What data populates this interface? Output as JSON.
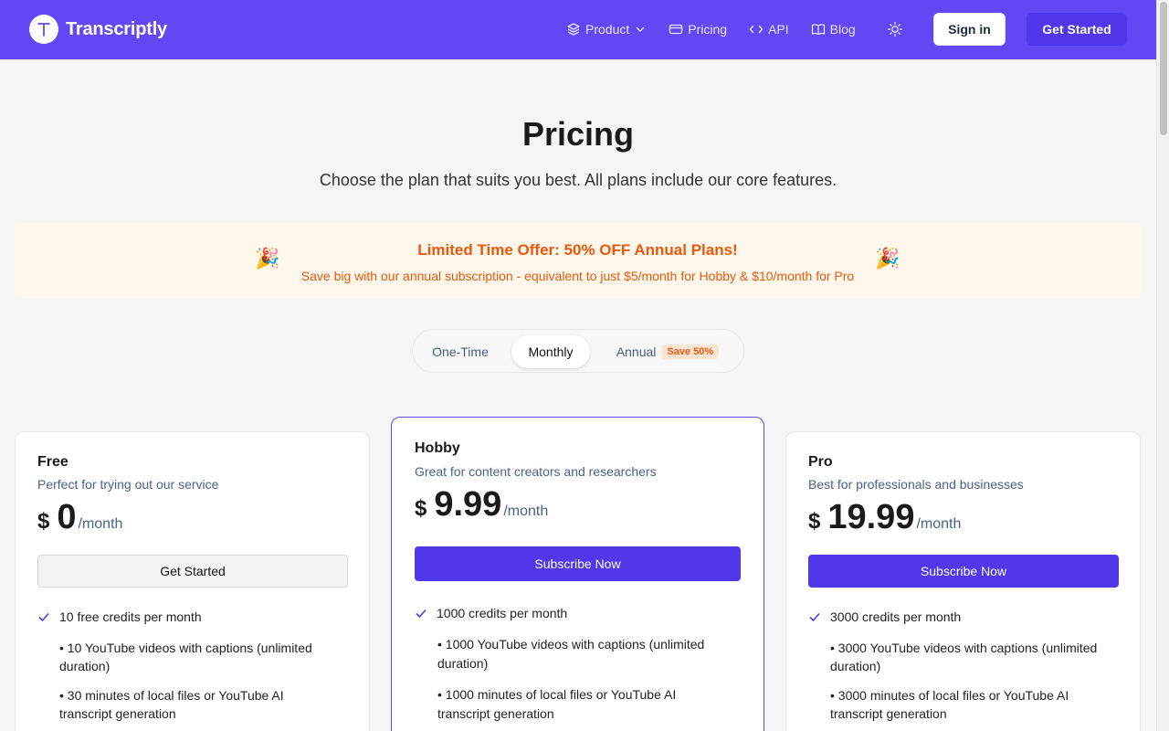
{
  "header": {
    "brand": "Transcriptly",
    "logo_letter": "T",
    "nav": {
      "product": "Product",
      "pricing": "Pricing",
      "api": "API",
      "blog": "Blog"
    },
    "sign_in": "Sign in",
    "get_started": "Get Started"
  },
  "page": {
    "title": "Pricing",
    "subtitle": "Choose the plan that suits you best. All plans include our core features."
  },
  "offer": {
    "title": "Limited Time Offer: 50% OFF Annual Plans!",
    "subtitle": "Save big with our annual subscription - equivalent to just $5/month for Hobby & $10/month for Pro",
    "emoji": "🎉"
  },
  "billing_toggle": {
    "one_time": "One-Time",
    "monthly": "Monthly",
    "annual": "Annual",
    "annual_badge": "Save 50%",
    "selected": "Monthly"
  },
  "plans": [
    {
      "name": "Free",
      "description": "Perfect for trying out our service",
      "currency": "$",
      "price": "0",
      "period": "/month",
      "button": "Get Started",
      "feature": "10 free credits per month",
      "sub_features": [
        "• 10 YouTube videos with captions (unlimited duration)",
        "• 30 minutes of local files or YouTube AI transcript generation"
      ]
    },
    {
      "name": "Hobby",
      "description": "Great for content creators and researchers",
      "currency": "$",
      "price": "9.99",
      "period": "/month",
      "button": "Subscribe Now",
      "feature": "1000 credits per month",
      "sub_features": [
        "• 1000 YouTube videos with captions (unlimited duration)",
        "• 1000 minutes of local files or YouTube AI transcript generation"
      ]
    },
    {
      "name": "Pro",
      "description": "Best for professionals and businesses",
      "currency": "$",
      "price": "19.99",
      "period": "/month",
      "button": "Subscribe Now",
      "feature": "3000 credits per month",
      "sub_features": [
        "• 3000 YouTube videos with captions (unlimited duration)",
        "• 3000 minutes of local files or YouTube AI transcript generation"
      ]
    }
  ],
  "colors": {
    "brand": "#6347f5",
    "primary_button": "#5137ea",
    "offer_text": "#ea580c",
    "offer_bg": "#fff7ec"
  }
}
